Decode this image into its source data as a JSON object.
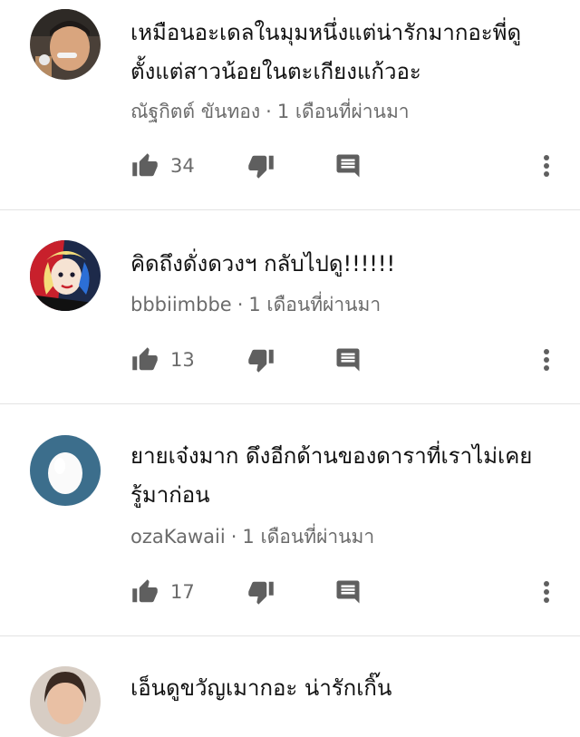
{
  "comments": [
    {
      "avatar_icon": "avatar-photo-man",
      "text_lines": [
        "เหมือนอะเดลในมุมหนึ่งแต่น่ารักมากอะพี่ดู",
        "ตั้งแต่สาวน้อยในตะเกียงแก้วอะ"
      ],
      "author": "ณัฐกิตต์ ขันทอง",
      "time": "1 เดือนที่ผ่านมา",
      "likes": "34"
    },
    {
      "avatar_icon": "avatar-cartoon-character",
      "text_lines": [
        "คิดถึงดั่งดวงฯ กลับไปดู!!!!!!"
      ],
      "author": "bbbiimbbe",
      "time": "1 เดือนที่ผ่านมา",
      "likes": "13"
    },
    {
      "avatar_icon": "avatar-default-egg",
      "text_lines": [
        "ยายเจ๋งมาก ดึงอีกด้านของดาราที่เราไม่เคย",
        "รู้มาก่อน"
      ],
      "author": "ozaKawaii",
      "time": "1 เดือนที่ผ่านมา",
      "likes": "17"
    },
    {
      "avatar_icon": "avatar-photo-woman",
      "text_lines": [
        "เอ็นดูขวัญเมากอะ  น่ารักเกิ๊น"
      ],
      "author": "",
      "time": "",
      "likes": ""
    }
  ],
  "separator": "·",
  "colors": {
    "text": "#111111",
    "meta": "#6b6b6b",
    "icon": "#5f5f5f",
    "divider": "#e3e3e3",
    "egg_avatar_bg": "#3c6e8c"
  }
}
